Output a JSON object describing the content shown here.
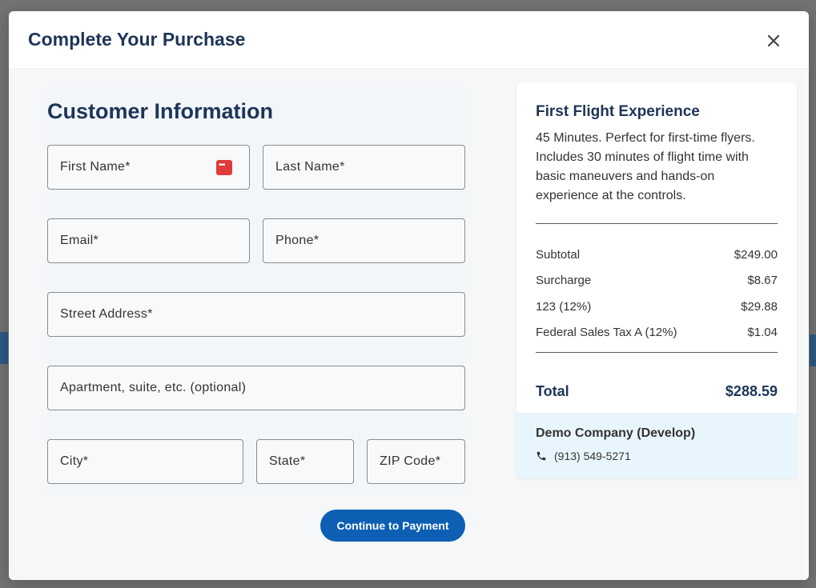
{
  "modal": {
    "title": "Complete Your Purchase"
  },
  "form": {
    "section_title": "Customer Information",
    "fields": {
      "first_name": "First Name*",
      "last_name": "Last Name*",
      "email": "Email*",
      "phone": "Phone*",
      "street": "Street Address*",
      "apartment": "Apartment, suite, etc. (optional)",
      "city": "City*",
      "state": "State*",
      "zip": "ZIP Code*"
    },
    "continue_label": "Continue to Payment"
  },
  "summary": {
    "title": "First Flight Experience",
    "description": "45 Minutes. Perfect for first-time flyers. Includes 30 minutes of flight time with basic maneuvers and hands-on experience at the controls.",
    "lines": [
      {
        "label": "Subtotal",
        "value": "$249.00"
      },
      {
        "label": "Surcharge",
        "value": "$8.67"
      },
      {
        "label": "123 (12%)",
        "value": "$29.88"
      },
      {
        "label": "Federal Sales Tax A (12%)",
        "value": "$1.04"
      }
    ],
    "total_label": "Total",
    "total_value": "$288.59"
  },
  "company": {
    "name": "Demo Company (Develop)",
    "phone": "(913) 549-5271"
  },
  "icons": {
    "close": "close-icon",
    "password_manager": "password-manager-icon",
    "phone": "phone-icon"
  },
  "colors": {
    "primary": "#0d5fb4",
    "heading": "#1d3557",
    "company_bg": "#e9f5fc"
  }
}
